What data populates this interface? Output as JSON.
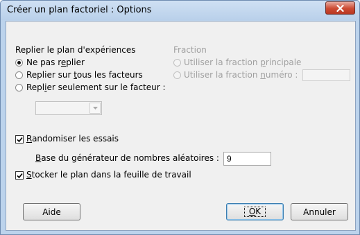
{
  "window": {
    "title": "Créer un plan factoriel : Options"
  },
  "replicate": {
    "group_label": "Replier le plan d'expériences",
    "options": [
      {
        "label_pre": "Ne pas r",
        "mnemonic": "e",
        "label_post": "plier",
        "checked": true
      },
      {
        "label_pre": "Replier sur ",
        "mnemonic": "t",
        "label_post": "ous les facteurs",
        "checked": false
      },
      {
        "label_pre": "Repl",
        "mnemonic": "i",
        "label_post": "er seulement sur le facteur :",
        "checked": false
      }
    ],
    "factor_select_value": ""
  },
  "fraction": {
    "group_label": "Fraction",
    "options": [
      {
        "label_pre": "Utiliser la fraction ",
        "mnemonic": "p",
        "label_post": "rincipale"
      },
      {
        "label_pre": "Utiliser la fraction ",
        "mnemonic": "n",
        "label_post": "uméro :"
      }
    ],
    "number_value": ""
  },
  "randomize": {
    "label_pre": "",
    "mnemonic": "R",
    "label_post": "andomiser les essais",
    "checked": true
  },
  "seed": {
    "label_pre": "",
    "mnemonic": "B",
    "label_post": "ase du générateur de nombres aléatoires :",
    "value": "9"
  },
  "store": {
    "label_pre": "",
    "mnemonic": "S",
    "label_post": "tocker le plan dans la feuille de travail",
    "checked": true
  },
  "buttons": {
    "help": "Aide",
    "ok_mnemonic": "O",
    "ok_rest": "K",
    "cancel": "Annuler"
  }
}
